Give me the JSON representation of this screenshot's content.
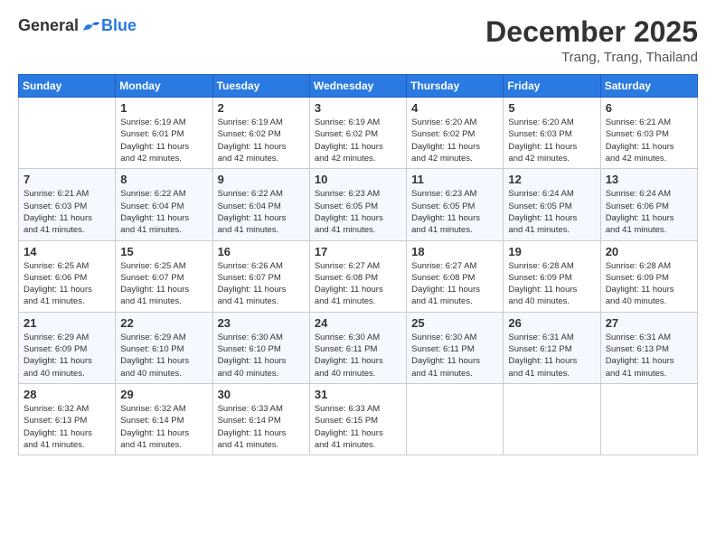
{
  "logo": {
    "general": "General",
    "blue": "Blue"
  },
  "title": "December 2025",
  "subtitle": "Trang, Trang, Thailand",
  "headers": [
    "Sunday",
    "Monday",
    "Tuesday",
    "Wednesday",
    "Thursday",
    "Friday",
    "Saturday"
  ],
  "weeks": [
    [
      {
        "day": "",
        "info": ""
      },
      {
        "day": "1",
        "info": "Sunrise: 6:19 AM\nSunset: 6:01 PM\nDaylight: 11 hours\nand 42 minutes."
      },
      {
        "day": "2",
        "info": "Sunrise: 6:19 AM\nSunset: 6:02 PM\nDaylight: 11 hours\nand 42 minutes."
      },
      {
        "day": "3",
        "info": "Sunrise: 6:19 AM\nSunset: 6:02 PM\nDaylight: 11 hours\nand 42 minutes."
      },
      {
        "day": "4",
        "info": "Sunrise: 6:20 AM\nSunset: 6:02 PM\nDaylight: 11 hours\nand 42 minutes."
      },
      {
        "day": "5",
        "info": "Sunrise: 6:20 AM\nSunset: 6:03 PM\nDaylight: 11 hours\nand 42 minutes."
      },
      {
        "day": "6",
        "info": "Sunrise: 6:21 AM\nSunset: 6:03 PM\nDaylight: 11 hours\nand 42 minutes."
      }
    ],
    [
      {
        "day": "7",
        "info": "Sunrise: 6:21 AM\nSunset: 6:03 PM\nDaylight: 11 hours\nand 41 minutes."
      },
      {
        "day": "8",
        "info": "Sunrise: 6:22 AM\nSunset: 6:04 PM\nDaylight: 11 hours\nand 41 minutes."
      },
      {
        "day": "9",
        "info": "Sunrise: 6:22 AM\nSunset: 6:04 PM\nDaylight: 11 hours\nand 41 minutes."
      },
      {
        "day": "10",
        "info": "Sunrise: 6:23 AM\nSunset: 6:05 PM\nDaylight: 11 hours\nand 41 minutes."
      },
      {
        "day": "11",
        "info": "Sunrise: 6:23 AM\nSunset: 6:05 PM\nDaylight: 11 hours\nand 41 minutes."
      },
      {
        "day": "12",
        "info": "Sunrise: 6:24 AM\nSunset: 6:05 PM\nDaylight: 11 hours\nand 41 minutes."
      },
      {
        "day": "13",
        "info": "Sunrise: 6:24 AM\nSunset: 6:06 PM\nDaylight: 11 hours\nand 41 minutes."
      }
    ],
    [
      {
        "day": "14",
        "info": "Sunrise: 6:25 AM\nSunset: 6:06 PM\nDaylight: 11 hours\nand 41 minutes."
      },
      {
        "day": "15",
        "info": "Sunrise: 6:25 AM\nSunset: 6:07 PM\nDaylight: 11 hours\nand 41 minutes."
      },
      {
        "day": "16",
        "info": "Sunrise: 6:26 AM\nSunset: 6:07 PM\nDaylight: 11 hours\nand 41 minutes."
      },
      {
        "day": "17",
        "info": "Sunrise: 6:27 AM\nSunset: 6:08 PM\nDaylight: 11 hours\nand 41 minutes."
      },
      {
        "day": "18",
        "info": "Sunrise: 6:27 AM\nSunset: 6:08 PM\nDaylight: 11 hours\nand 41 minutes."
      },
      {
        "day": "19",
        "info": "Sunrise: 6:28 AM\nSunset: 6:09 PM\nDaylight: 11 hours\nand 40 minutes."
      },
      {
        "day": "20",
        "info": "Sunrise: 6:28 AM\nSunset: 6:09 PM\nDaylight: 11 hours\nand 40 minutes."
      }
    ],
    [
      {
        "day": "21",
        "info": "Sunrise: 6:29 AM\nSunset: 6:09 PM\nDaylight: 11 hours\nand 40 minutes."
      },
      {
        "day": "22",
        "info": "Sunrise: 6:29 AM\nSunset: 6:10 PM\nDaylight: 11 hours\nand 40 minutes."
      },
      {
        "day": "23",
        "info": "Sunrise: 6:30 AM\nSunset: 6:10 PM\nDaylight: 11 hours\nand 40 minutes."
      },
      {
        "day": "24",
        "info": "Sunrise: 6:30 AM\nSunset: 6:11 PM\nDaylight: 11 hours\nand 40 minutes."
      },
      {
        "day": "25",
        "info": "Sunrise: 6:30 AM\nSunset: 6:11 PM\nDaylight: 11 hours\nand 41 minutes."
      },
      {
        "day": "26",
        "info": "Sunrise: 6:31 AM\nSunset: 6:12 PM\nDaylight: 11 hours\nand 41 minutes."
      },
      {
        "day": "27",
        "info": "Sunrise: 6:31 AM\nSunset: 6:13 PM\nDaylight: 11 hours\nand 41 minutes."
      }
    ],
    [
      {
        "day": "28",
        "info": "Sunrise: 6:32 AM\nSunset: 6:13 PM\nDaylight: 11 hours\nand 41 minutes."
      },
      {
        "day": "29",
        "info": "Sunrise: 6:32 AM\nSunset: 6:14 PM\nDaylight: 11 hours\nand 41 minutes."
      },
      {
        "day": "30",
        "info": "Sunrise: 6:33 AM\nSunset: 6:14 PM\nDaylight: 11 hours\nand 41 minutes."
      },
      {
        "day": "31",
        "info": "Sunrise: 6:33 AM\nSunset: 6:15 PM\nDaylight: 11 hours\nand 41 minutes."
      },
      {
        "day": "",
        "info": ""
      },
      {
        "day": "",
        "info": ""
      },
      {
        "day": "",
        "info": ""
      }
    ]
  ]
}
